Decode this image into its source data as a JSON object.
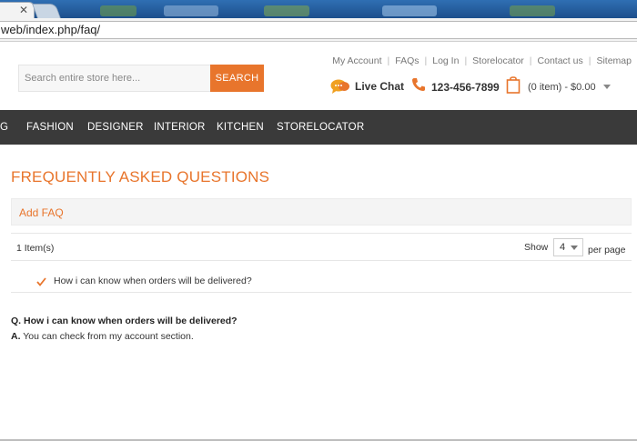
{
  "browser": {
    "url": "web/index.php/faq/"
  },
  "header": {
    "top_links": [
      "My Account",
      "FAQs",
      "Log In",
      "Storelocator",
      "Contact us",
      "Sitemap"
    ],
    "search_placeholder": "Search entire store here...",
    "search_button": "SEARCH",
    "live_chat": "Live Chat",
    "phone": "123-456-7899",
    "cart": "(0 item) - $0.00"
  },
  "nav": {
    "items": [
      "G",
      "FASHION",
      "DESIGNER",
      "INTERIOR",
      "KITCHEN",
      "STORELOCATOR"
    ]
  },
  "content": {
    "title": "FREQUENTLY ASKED QUESTIONS",
    "add_faq": "Add FAQ",
    "items_count": "1 Item(s)",
    "show_label": "Show",
    "per_page_value": "4",
    "per_page_label": "per page",
    "faq_list": [
      "How i can know when orders will be delivered?"
    ],
    "qa": {
      "q_prefix": "Q.",
      "question": "How i can know when orders will be delivered?",
      "a_prefix": "A.",
      "answer": "You can check from my account section."
    }
  },
  "colors": {
    "accent": "#e8752c",
    "nav_bg": "#3a3a3a"
  }
}
